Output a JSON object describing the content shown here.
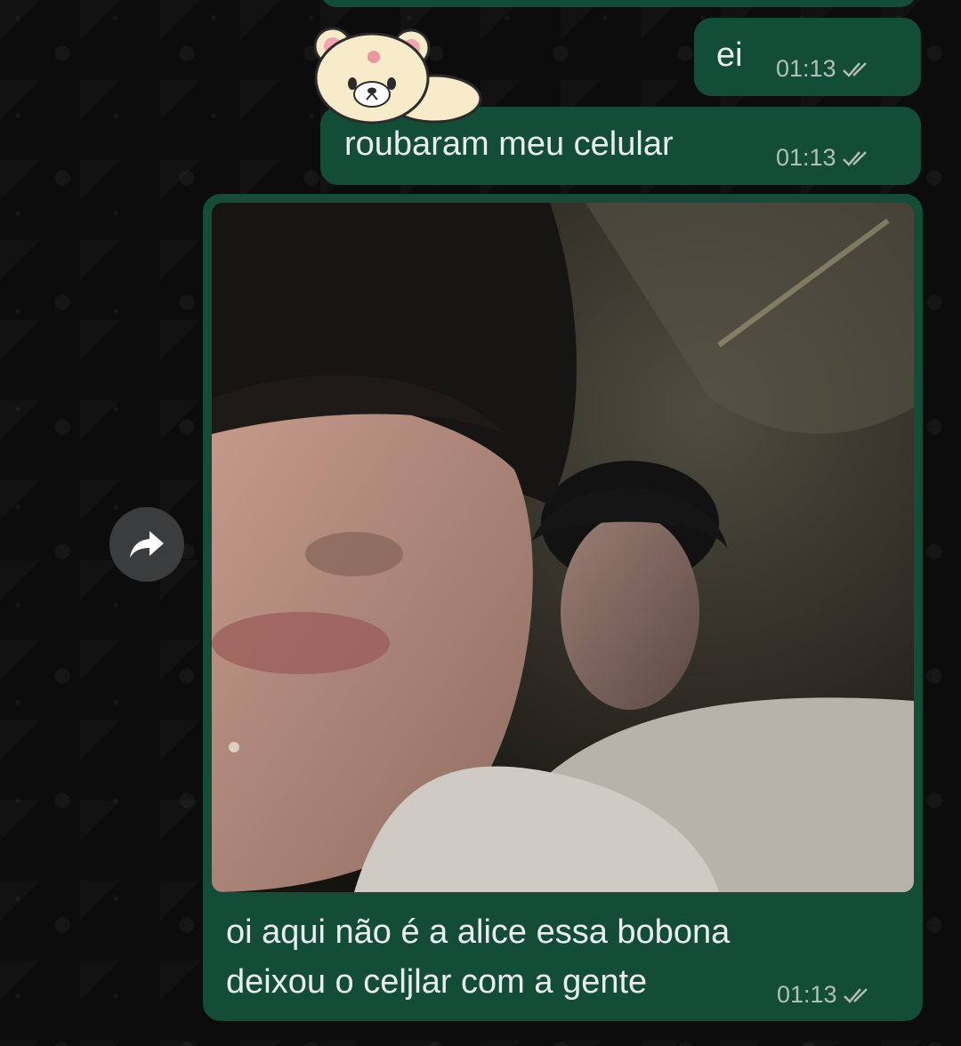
{
  "chat": {
    "messages": [
      {
        "text": "ei",
        "time": "01:13",
        "status": "read"
      },
      {
        "text": "roubaram meu celular",
        "time": "01:13",
        "status": "read"
      },
      {
        "type": "image_with_caption",
        "caption_line1": "oi aqui não é a alice essa bobona",
        "caption_line2": "deixou o celjlar com a gente",
        "time": "01:13",
        "status": "read"
      }
    ],
    "sticker": {
      "icon": "teddy-bear-sticker"
    },
    "forward_icon": "forward-arrow-icon"
  },
  "colors": {
    "outgoing_bubble": "#134d37",
    "text": "#e9edef",
    "meta": "#b2bbb6",
    "background": "#0c0c0c",
    "forward_button": "#3a3c3e"
  }
}
